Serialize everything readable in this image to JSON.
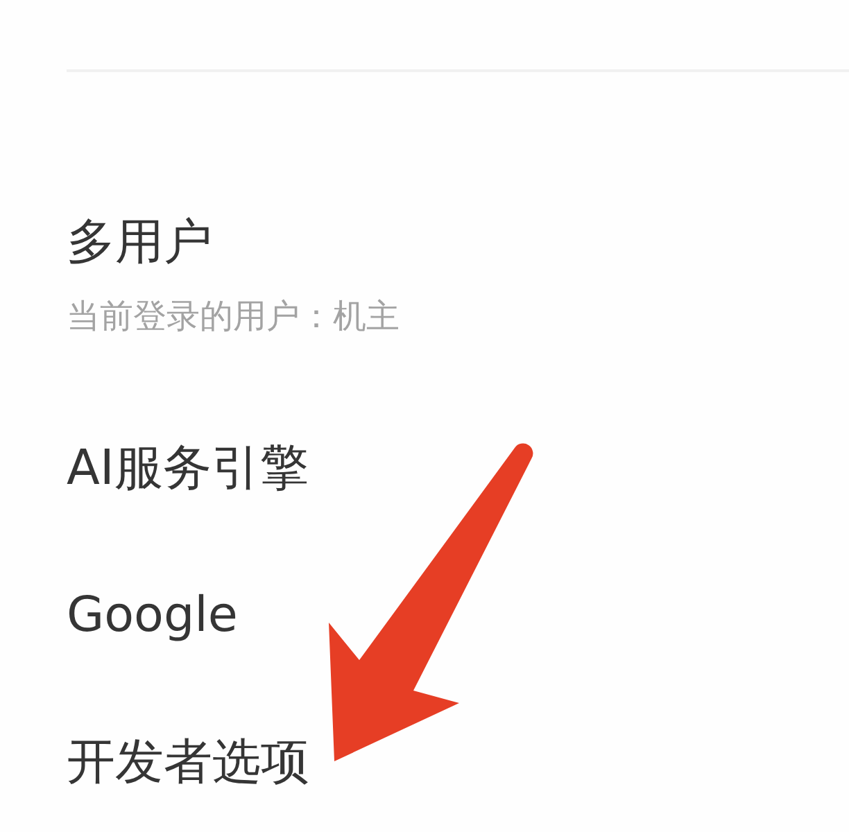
{
  "items": [
    {
      "title": "多用户",
      "subtitle": "当前登录的用户：机主"
    },
    {
      "title": "AI服务引擎"
    },
    {
      "title": "Google"
    },
    {
      "title": "开发者选项"
    }
  ]
}
